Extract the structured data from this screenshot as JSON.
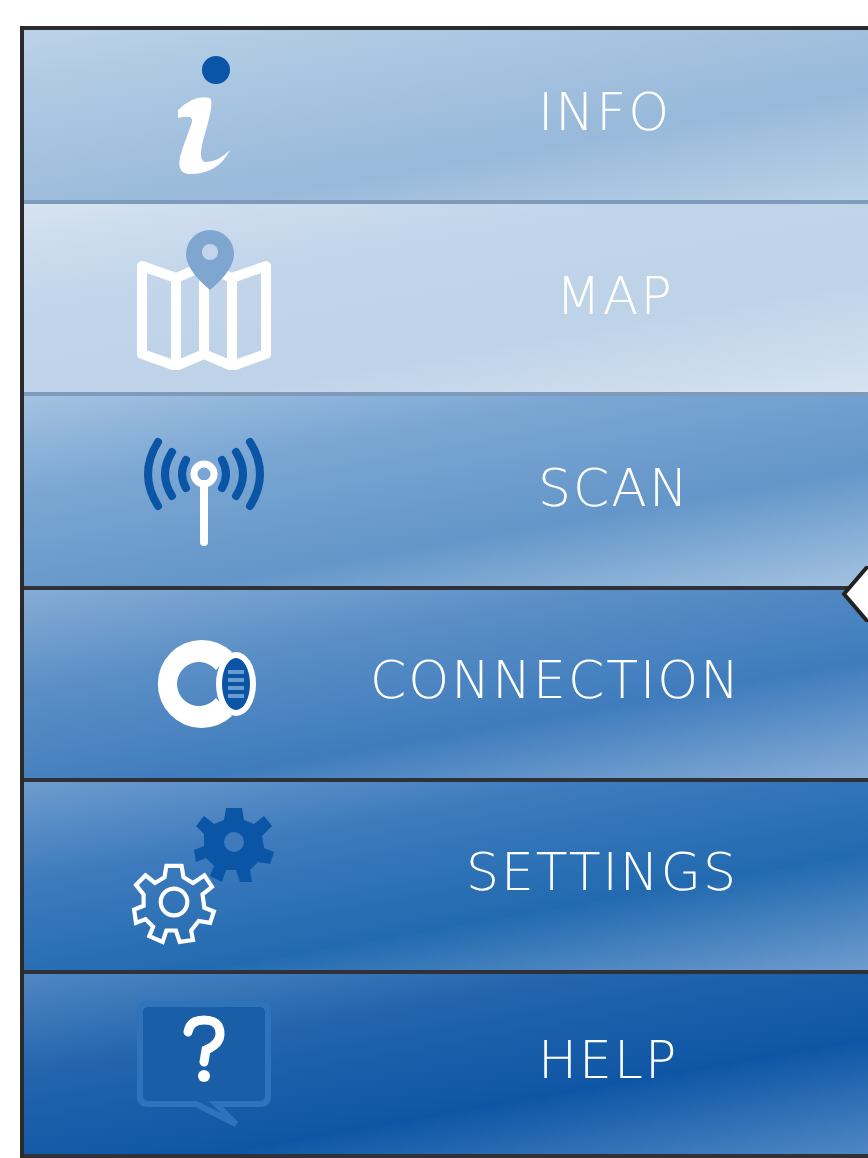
{
  "menu": [
    {
      "label": "INFO",
      "kind": "info"
    },
    {
      "label": "MAP",
      "kind": "map"
    },
    {
      "label": "SCAN",
      "kind": "scan"
    },
    {
      "label": "CONNECTION",
      "kind": "connection"
    },
    {
      "label": "SETTINGS",
      "kind": "settings"
    },
    {
      "label": "HELP",
      "kind": "help"
    }
  ]
}
